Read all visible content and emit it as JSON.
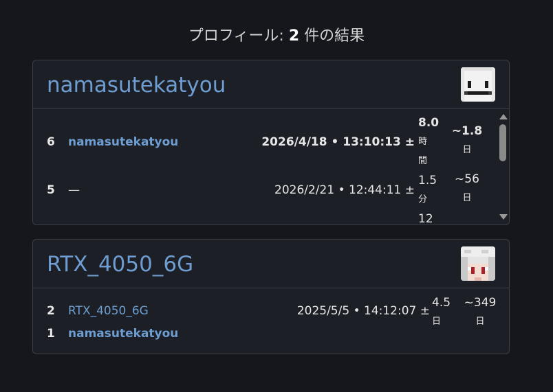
{
  "header": {
    "prefix": "プロフィール: ",
    "count": "2",
    "suffix": " 件の結果"
  },
  "profiles": [
    {
      "title": "namasutekatyou",
      "avatar_icon": "white-smiley-skin-icon",
      "rows": [
        {
          "rank": "6",
          "name": "namasutekatyou",
          "timestamp": "2026/4/18 • 13:10:13 ±",
          "pm_value": "8.0",
          "pm_unit_1": "時",
          "pm_unit_2": "間",
          "age_value": "~1.8",
          "age_unit": "日"
        },
        {
          "rank": "5",
          "name": "—",
          "timestamp": "2026/2/21 • 12:44:11 ±",
          "pm_value": "1.5",
          "pm_unit_1": "分",
          "pm_unit_2": "12",
          "age_value": "~56",
          "age_unit": "日"
        }
      ]
    },
    {
      "title": "RTX_4050_6G",
      "avatar_icon": "white-hair-red-eyes-skin-icon",
      "rows": [
        {
          "rank": "2",
          "name": "RTX_4050_6G",
          "timestamp": "2025/5/5 • 14:12:07 ±",
          "pm_value": "4.5",
          "pm_unit": "日",
          "age_value": "~349",
          "age_unit": "日"
        },
        {
          "rank": "1",
          "name": "namasutekatyou"
        }
      ]
    }
  ],
  "colors": {
    "background": "#15171c",
    "card": "#1c1f25",
    "border": "#3a3e46",
    "link": "#6e9dd1"
  }
}
